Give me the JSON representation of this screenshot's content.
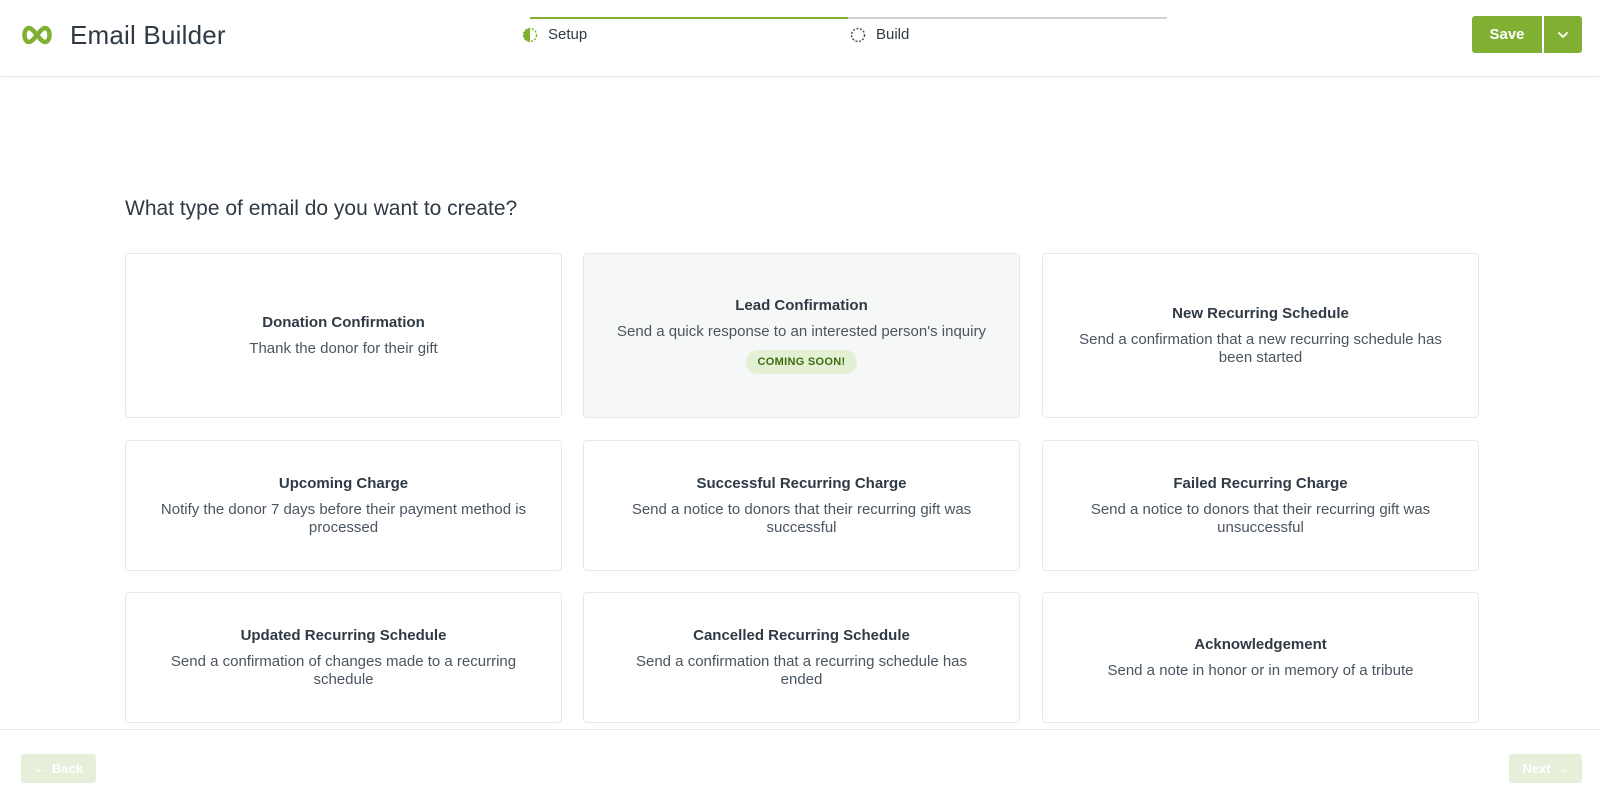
{
  "header": {
    "app_title": "Email Builder",
    "save_label": "Save",
    "brand_color": "#7fb032"
  },
  "stepper": {
    "steps": [
      {
        "label": "Setup",
        "state": "in-progress"
      },
      {
        "label": "Build",
        "state": "pending"
      }
    ]
  },
  "main": {
    "question": "What type of email do you want to create?",
    "cards": [
      {
        "title": "Donation Confirmation",
        "description": "Thank the donor for their gift"
      },
      {
        "title": "Lead Confirmation",
        "description": "Send a quick response to an interested person's inquiry",
        "badge": "COMING SOON!"
      },
      {
        "title": "New Recurring Schedule",
        "description": "Send a confirmation that a new recurring schedule has been started"
      },
      {
        "title": "Upcoming Charge",
        "description": "Notify the donor 7 days before their payment method is processed"
      },
      {
        "title": "Successful Recurring Charge",
        "description": "Send a notice to donors that their recurring gift was successful"
      },
      {
        "title": "Failed Recurring Charge",
        "description": "Send a notice to donors that their recurring gift was unsuccessful"
      },
      {
        "title": "Updated Recurring Schedule",
        "description": "Send a confirmation of changes made to a recurring schedule"
      },
      {
        "title": "Cancelled Recurring Schedule",
        "description": "Send a confirmation that a recurring schedule has ended"
      },
      {
        "title": "Acknowledgement",
        "description": "Send a note in honor or in memory of a tribute"
      }
    ]
  },
  "footer": {
    "back_label": "Back",
    "next_label": "Next"
  }
}
